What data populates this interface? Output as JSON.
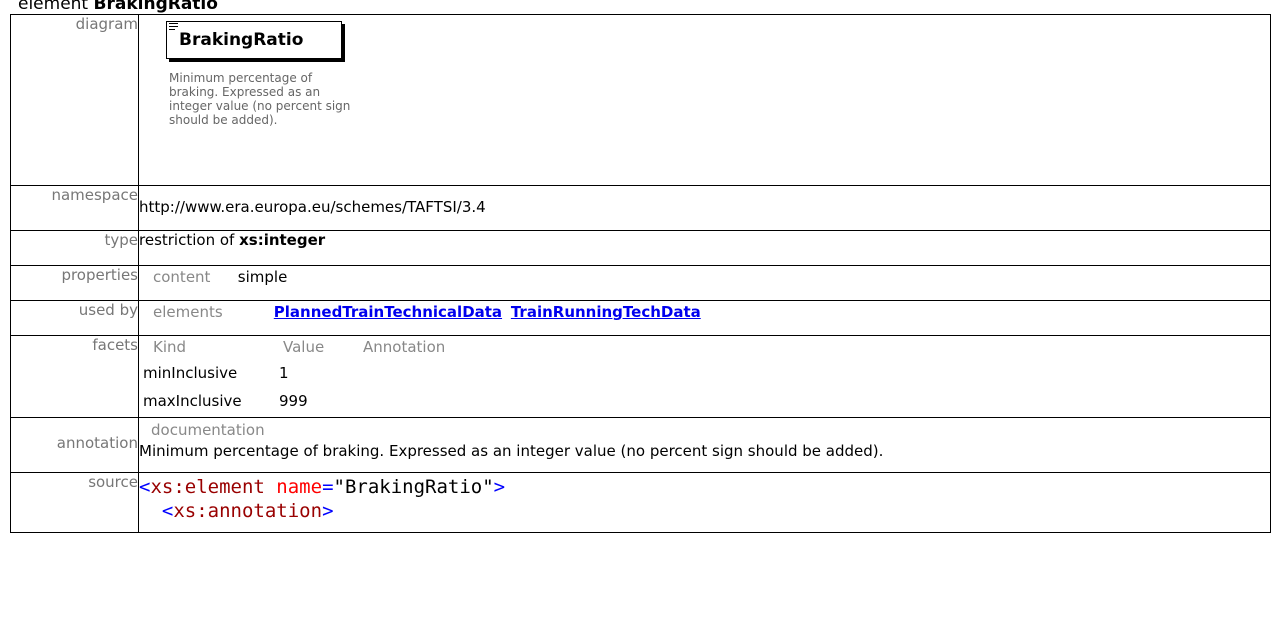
{
  "heading": {
    "prefix": "element",
    "name": "BrakingRatio"
  },
  "rows": {
    "diagram": {
      "label": "diagram",
      "element_name": "BrakingRatio",
      "doc_text": "Minimum percentage of braking. Expressed as an integer value (no percent sign should be added)."
    },
    "namespace": {
      "label": "namespace",
      "value": "http://www.era.europa.eu/schemes/TAFTSI/3.4"
    },
    "type": {
      "label": "type",
      "prefix": "restriction of",
      "base": "xs:integer"
    },
    "properties": {
      "label": "properties",
      "key": "content",
      "value": "simple"
    },
    "used_by": {
      "label": "used by",
      "key": "elements",
      "links": [
        "PlannedTrainTechnicalData",
        "TrainRunningTechData"
      ]
    },
    "facets": {
      "label": "facets",
      "headers": [
        "Kind",
        "Value",
        "Annotation"
      ],
      "rows": [
        {
          "kind": "minInclusive",
          "value": "1"
        },
        {
          "kind": "maxInclusive",
          "value": "999"
        }
      ]
    },
    "annotation": {
      "label": "annotation",
      "sub_label": "documentation",
      "text": "Minimum percentage of braking. Expressed as an integer value (no percent sign should be added)."
    },
    "source": {
      "label": "source",
      "line1": {
        "open": "<",
        "tag": "xs:element",
        "attr": "name",
        "eq": "=",
        "val": "\"BrakingRatio\"",
        "close": ">"
      },
      "line2": {
        "indent": "  ",
        "open": "<",
        "tag": "xs:annotation",
        "close": ">"
      }
    }
  }
}
